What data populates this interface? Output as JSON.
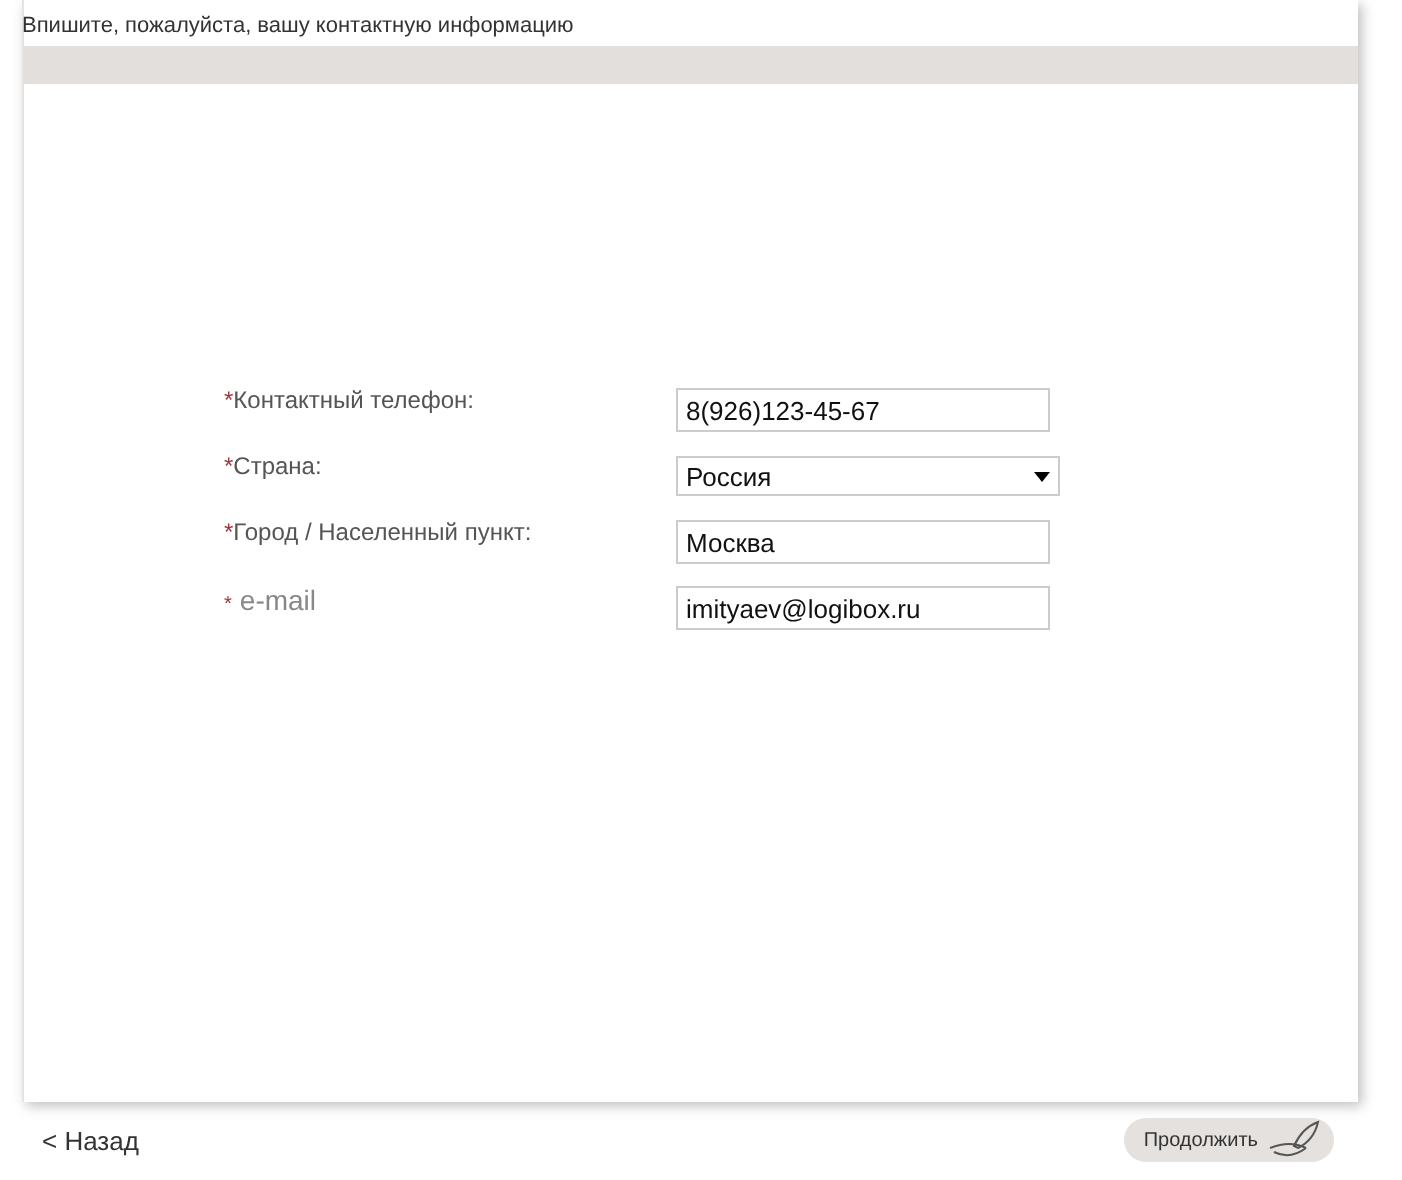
{
  "header": {
    "title": "Впишите, пожалуйста, вашу контактную информацию"
  },
  "form": {
    "fields": [
      {
        "mark": "*",
        "label": "Контактный телефон:",
        "kind": "text",
        "value": "8(926)123-45-67"
      },
      {
        "mark": "*",
        "label": "Страна:",
        "kind": "select",
        "value": "Россия"
      },
      {
        "mark": "*",
        "label": "Город / Населенный пункт:",
        "kind": "text",
        "value": "Москва"
      },
      {
        "mark": "*",
        "label": "e-mail",
        "kind": "email",
        "value": "imityaev@logibox.ru"
      }
    ]
  },
  "footer": {
    "back": "< Назад",
    "next": "Продолжить"
  }
}
